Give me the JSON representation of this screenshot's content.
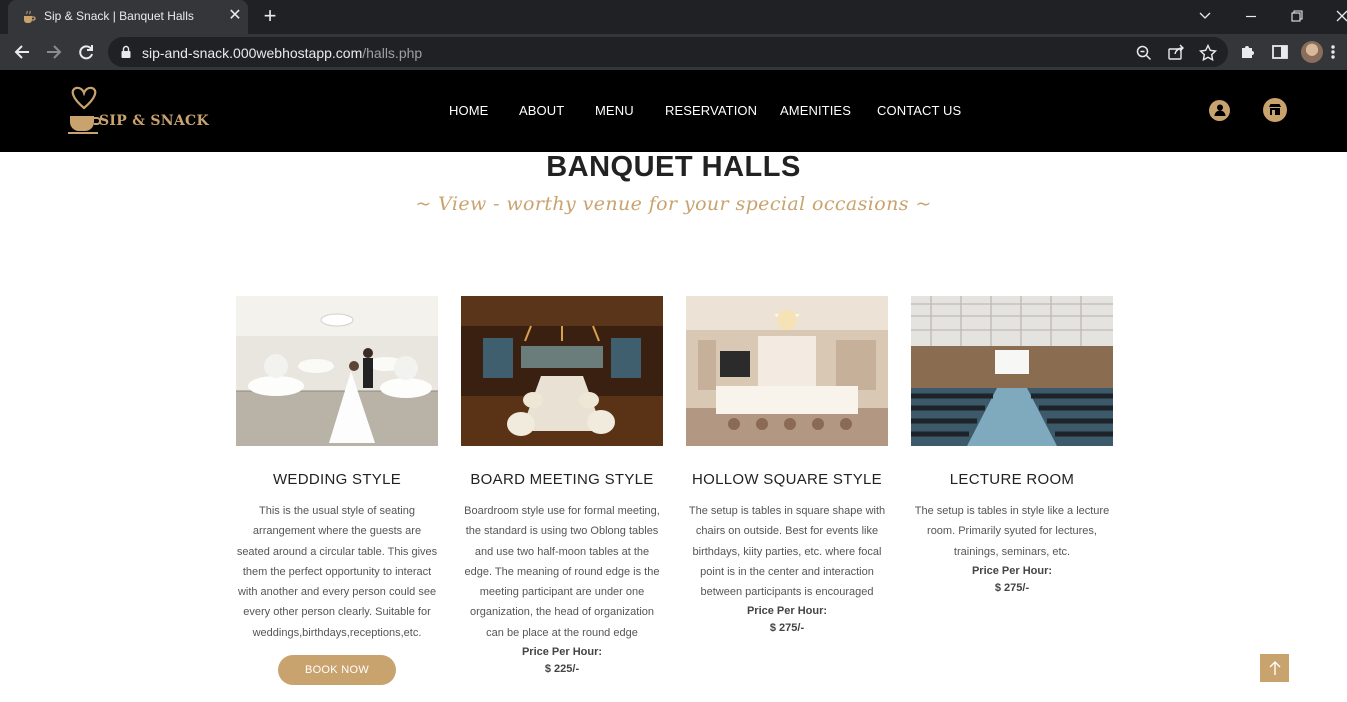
{
  "browser": {
    "tab_title": "Sip & Snack | Banquet Halls",
    "url_host": "sip-and-snack.000webhostapp.com",
    "url_path": "/halls.php"
  },
  "site": {
    "logo_text": "SIP & SNACK",
    "nav": [
      "HOME",
      "ABOUT",
      "MENU",
      "RESERVATION",
      "AMENITIES",
      "CONTACT US"
    ],
    "accent_color": "#c9a36e"
  },
  "page": {
    "title": "BANQUET HALLS",
    "subtitle": "~ View - worthy venue for your special occasions ~"
  },
  "halls": [
    {
      "title": "WEDDING STYLE",
      "description": "This is the usual style of seating arrangement where the guests are seated around a circular table. This gives them the perfect opportunity to interact with another and every person could see every other person clearly. Suitable for weddings,birthdays,receptions,etc.",
      "price_label": "",
      "price": "",
      "button": "BOOK NOW"
    },
    {
      "title": "BOARD MEETING STYLE",
      "description": "Boardroom style use for formal meeting, the standard is using two Oblong tables and use two half-moon tables at the edge. The meaning of round edge is the meeting participant are under one organization, the head of organization can be place at the round edge",
      "price_label": "Price Per Hour:",
      "price": "$ 225/-"
    },
    {
      "title": "HOLLOW SQUARE STYLE",
      "description": "The setup is tables in square shape with chairs on outside. Best for events like birthdays, kiity parties, etc. where focal point is in the center and interaction between participants is encouraged",
      "price_label": "Price Per Hour:",
      "price": "$ 275/-"
    },
    {
      "title": "LECTURE ROOM",
      "description": "The setup is tables in style like a lecture room. Primarily syuted for lectures, trainings, seminars, etc.",
      "price_label": "Price Per Hour:",
      "price": "$ 275/-"
    }
  ]
}
